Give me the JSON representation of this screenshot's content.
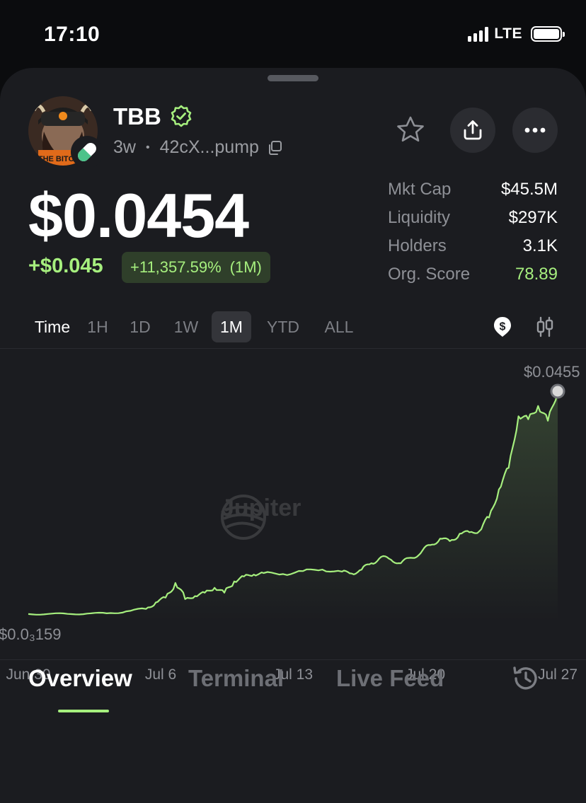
{
  "status_bar": {
    "time": "17:10",
    "network": "LTE"
  },
  "token": {
    "name": "TBB",
    "age": "3w",
    "address_short": "42cX...pump",
    "avatar_text": "THE BITCOIN",
    "price": "$0.0454",
    "change_abs": "+$0.045",
    "change_pct": "+11,357.59%",
    "change_period": "(1M)"
  },
  "stats": [
    {
      "label": "Mkt Cap",
      "value": "$45.5M",
      "green": false
    },
    {
      "label": "Liquidity",
      "value": "$297K",
      "green": false
    },
    {
      "label": "Holders",
      "value": "3.1K",
      "green": false
    },
    {
      "label": "Org. Score",
      "value": "78.89",
      "green": true
    }
  ],
  "time_tabs": {
    "label": "Time",
    "items": [
      "1H",
      "1D",
      "1W",
      "1M",
      "YTD",
      "ALL"
    ],
    "active": "1M"
  },
  "chart_watermark": "Jupiter",
  "chart_data": {
    "type": "line",
    "title": "",
    "xlabel": "",
    "ylabel": "",
    "max_label": "$0.0455",
    "min_label": "$0.0₃159",
    "x_ticks": [
      "Jun 30",
      "Jul 6",
      "Jul 13",
      "Jul 20",
      "Jul 27"
    ],
    "ylim": [
      0,
      0.0455
    ],
    "series": [
      {
        "x": [
          "Jun 30",
          "Jul 1",
          "Jul 2",
          "Jul 3",
          "Jul 4",
          "Jul 5",
          "Jul 6",
          "Jul 6",
          "Jul 7",
          "Jul 7",
          "Jul 8",
          "Jul 8",
          "Jul 9",
          "Jul 9",
          "Jul 10",
          "Jul 10",
          "Jul 11",
          "Jul 11",
          "Jul 12",
          "Jul 13",
          "Jul 14",
          "Jul 15",
          "Jul 16",
          "Jul 16",
          "Jul 17",
          "Jul 17",
          "Jul 18",
          "Jul 18",
          "Jul 19",
          "Jul 19",
          "Jul 20",
          "Jul 20",
          "Jul 21",
          "Jul 21",
          "Jul 22",
          "Jul 22",
          "Jul 23",
          "Jul 23",
          "Jul 24",
          "Jul 24",
          "Jul 25",
          "Jul 25",
          "Jul 26",
          "Jul 26",
          "Jul 27"
        ],
        "y": [
          0.00016,
          0.00017,
          0.00019,
          0.00025,
          0.0003,
          0.0007,
          0.0012,
          0.0025,
          0.0035,
          0.0065,
          0.0032,
          0.0038,
          0.0045,
          0.0055,
          0.0045,
          0.0068,
          0.0078,
          0.0082,
          0.0085,
          0.0083,
          0.0089,
          0.0092,
          0.0088,
          0.0084,
          0.0092,
          0.0105,
          0.0118,
          0.0112,
          0.0105,
          0.0116,
          0.0125,
          0.0142,
          0.0155,
          0.015,
          0.0165,
          0.0168,
          0.017,
          0.0198,
          0.0255,
          0.0299,
          0.0404,
          0.0398,
          0.0425,
          0.0395,
          0.0455
        ]
      }
    ],
    "line_color": "#a6ef7e"
  },
  "bottom_nav": {
    "items": [
      "Overview",
      "Terminal",
      "Live Feed"
    ],
    "active": "Overview"
  }
}
